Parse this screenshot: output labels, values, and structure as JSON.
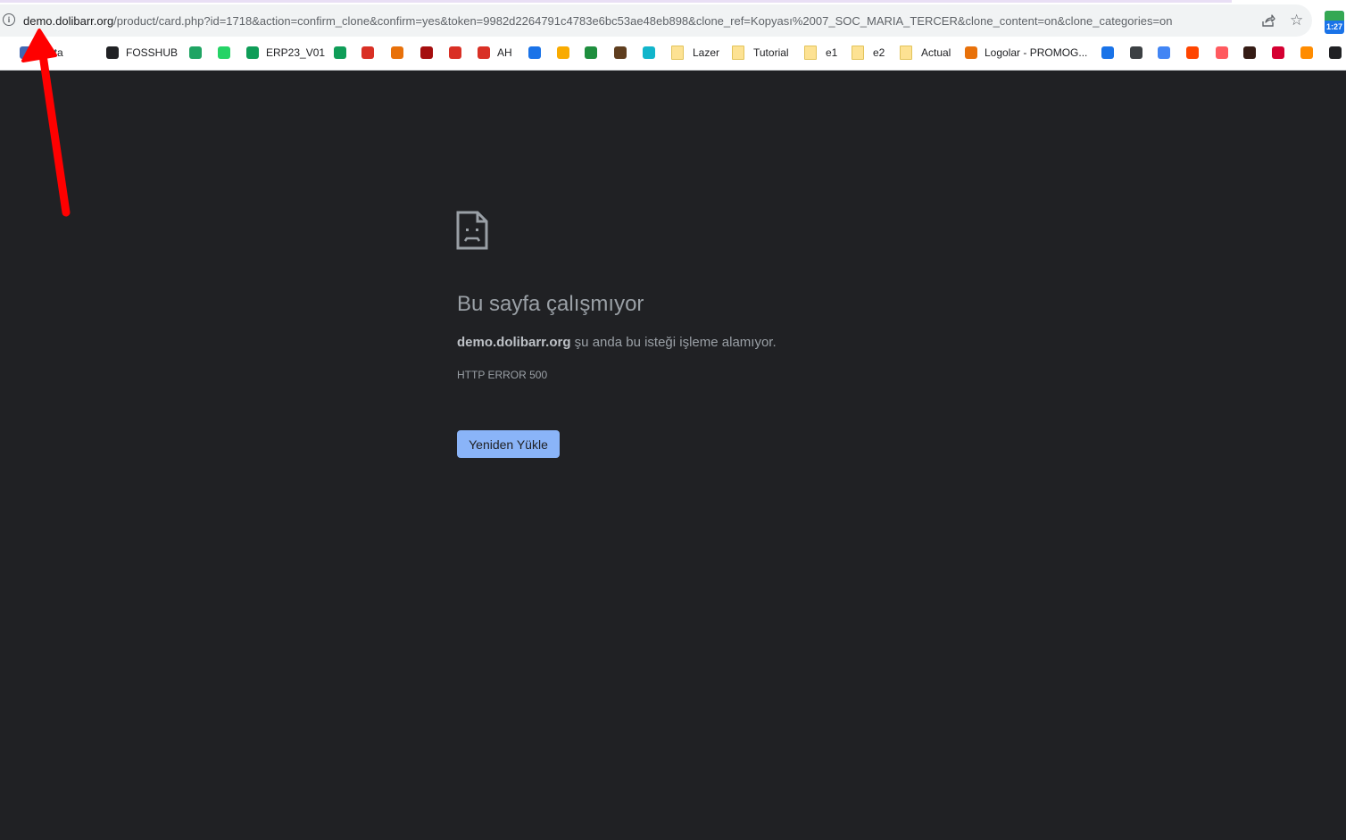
{
  "browser": {
    "url_host": "demo.dolibarr.org",
    "url_rest": "/product/card.php?id=1718&action=confirm_clone&confirm=yes&token=9982d2264791c4783e6bc53ae48eb898&clone_ref=Kopyası%2007_SOC_MARIA_TERCER&clone_content=on&clone_categories=on",
    "extension_badge": "1:27"
  },
  "bookmarks": [
    {
      "label": "Meta",
      "icon": "meta-icon",
      "color": "#4267b2"
    },
    {
      "label": "FOSSHUB",
      "icon": "fosshub-icon",
      "color": "#202124"
    },
    {
      "label": "",
      "icon": "google-drive-icon",
      "color": "#1fa463"
    },
    {
      "label": "",
      "icon": "whatsapp-icon",
      "color": "#25d366"
    },
    {
      "label": "ERP23_V01",
      "icon": "google-sheets-icon",
      "color": "#0f9d58"
    },
    {
      "label": "",
      "icon": "google-sheets-icon",
      "color": "#0f9d58"
    },
    {
      "label": "",
      "icon": "red-swirl-icon",
      "color": "#d93025"
    },
    {
      "label": "",
      "icon": "cp-icon",
      "color": "#e8710a"
    },
    {
      "label": "",
      "icon": "1k-icon",
      "color": "#a50e0e"
    },
    {
      "label": "",
      "icon": "document-red-icon",
      "color": "#d93025"
    },
    {
      "label": "AH",
      "icon": "document-red-icon",
      "color": "#d93025"
    },
    {
      "label": "",
      "icon": "calendar-icon",
      "color": "#1a73e8"
    },
    {
      "label": "",
      "icon": "flame-icon",
      "color": "#f9ab00"
    },
    {
      "label": "",
      "icon": "mountain-icon",
      "color": "#1e8e3e"
    },
    {
      "label": "",
      "icon": "face-icon",
      "color": "#5f3e1f"
    },
    {
      "label": "",
      "icon": "globe-icon",
      "color": "#12b5cb"
    },
    {
      "label": "Lazer",
      "icon": "folder-icon",
      "color": "#fde293"
    },
    {
      "label": "Tutorial",
      "icon": "folder-icon",
      "color": "#fde293"
    },
    {
      "label": "e1",
      "icon": "folder-icon",
      "color": "#fde293"
    },
    {
      "label": "e2",
      "icon": "folder-icon",
      "color": "#fde293"
    },
    {
      "label": "Actual",
      "icon": "folder-icon",
      "color": "#fde293"
    },
    {
      "label": "Logolar - PROMOG...",
      "icon": "p-logo-icon",
      "color": "#e8710a"
    },
    {
      "label": "",
      "icon": "person-icon",
      "color": "#1a73e8"
    },
    {
      "label": "",
      "icon": "terminal-icon",
      "color": "#3c4043"
    },
    {
      "label": "",
      "icon": "translate-icon",
      "color": "#4285f4"
    },
    {
      "label": "",
      "icon": "reddit-icon",
      "color": "#ff4500"
    },
    {
      "label": "",
      "icon": "airbnb-icon",
      "color": "#ff5a5f"
    },
    {
      "label": "",
      "icon": "ups-icon",
      "color": "#351c15"
    },
    {
      "label": "",
      "icon": "a-red-icon",
      "color": "#d50032"
    },
    {
      "label": "",
      "icon": "t-orange-icon",
      "color": "#ff8c00"
    },
    {
      "label": "",
      "icon": "dw-icon",
      "color": "#202124"
    }
  ],
  "error": {
    "title": "Bu sayfa çalışmıyor",
    "host": "demo.dolibarr.org",
    "message": " şu anda bu isteği işleme alamıyor.",
    "code": "HTTP ERROR 500",
    "reload_button": "Yeniden Yükle"
  },
  "colors": {
    "page_background": "#202124",
    "button": "#8ab4f8",
    "annotation_arrow": "#ff0000"
  }
}
